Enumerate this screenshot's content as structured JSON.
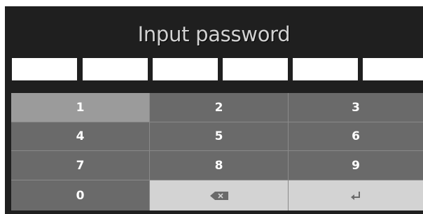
{
  "dialog": {
    "title": "Input password",
    "pin_slots": 6
  },
  "keypad": {
    "keys": [
      {
        "label": "1",
        "state": "pressed"
      },
      {
        "label": "2",
        "state": "normal"
      },
      {
        "label": "3",
        "state": "normal"
      },
      {
        "label": "4",
        "state": "normal"
      },
      {
        "label": "5",
        "state": "normal"
      },
      {
        "label": "6",
        "state": "normal"
      },
      {
        "label": "7",
        "state": "normal"
      },
      {
        "label": "8",
        "state": "normal"
      },
      {
        "label": "9",
        "state": "normal"
      },
      {
        "label": "0",
        "state": "normal"
      }
    ],
    "backspace_icon": "backspace-icon",
    "enter_icon": "enter-icon"
  },
  "colors": {
    "panel_bg": "#1f1f1f",
    "key_bg": "#6a6a6a",
    "key_pressed_bg": "#9b9b9b",
    "action_key_bg": "#d3d3d3",
    "pin_slot_bg": "#ffffff"
  }
}
